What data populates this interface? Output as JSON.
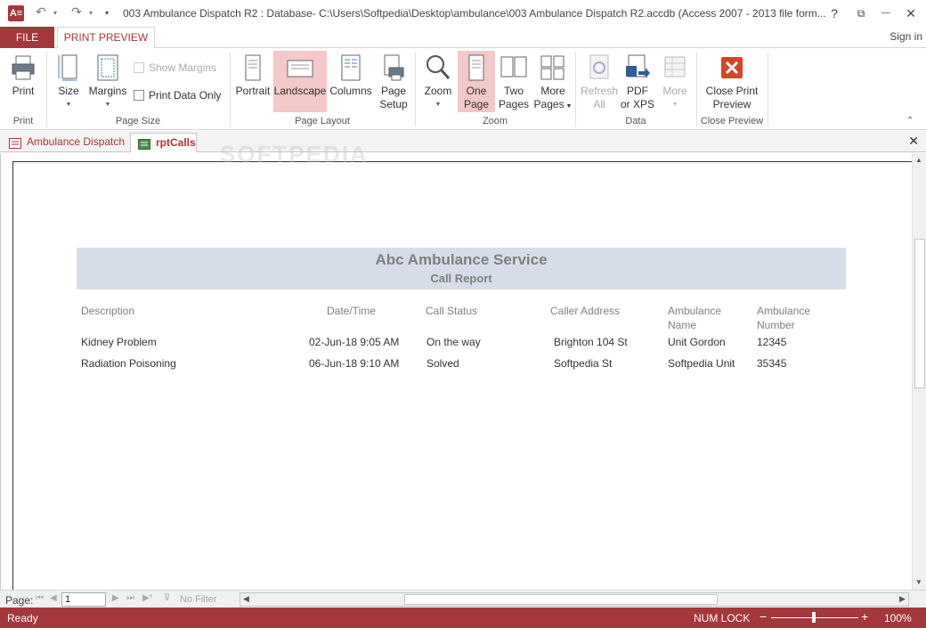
{
  "window": {
    "title": "003 Ambulance Dispatch R2 : Database- C:\\Users\\Softpedia\\Desktop\\ambulance\\003 Ambulance Dispatch R2.accdb (Access 2007 - 2013 file form...",
    "app_icon_text": "A≡",
    "help": "?",
    "restore": "⧉",
    "minimize": "—",
    "maximize": "☐",
    "close": "✕"
  },
  "tabs": {
    "file": "FILE",
    "print_preview": "PRINT PREVIEW",
    "sign_in": "Sign in"
  },
  "ribbon": {
    "print": {
      "label": "Print",
      "group": "Print"
    },
    "page_size": {
      "size": "Size",
      "margins": "Margins",
      "show_margins": "Show Margins",
      "print_data_only": "Print Data Only",
      "group": "Page Size"
    },
    "page_layout": {
      "portrait": "Portrait",
      "landscape": "Landscape",
      "columns": "Columns",
      "page_setup_1": "Page",
      "page_setup_2": "Setup",
      "group": "Page Layout"
    },
    "zoom": {
      "zoom": "Zoom",
      "one_page_1": "One",
      "one_page_2": "Page",
      "two_pages_1": "Two",
      "two_pages_2": "Pages",
      "more_pages_1": "More",
      "more_pages_2": "Pages",
      "group": "Zoom"
    },
    "data": {
      "refresh_1": "Refresh",
      "refresh_2": "All",
      "pdf_1": "PDF",
      "pdf_2": "or XPS",
      "more": "More",
      "group": "Data"
    },
    "close_preview": {
      "label_1": "Close Print",
      "label_2": "Preview",
      "group": "Close Preview"
    }
  },
  "doc_tabs": [
    {
      "label": "Ambulance Dispatch"
    },
    {
      "label": "rptCalls"
    }
  ],
  "watermark": "SOFTPEDIA",
  "report": {
    "title": "Abc Ambulance Service",
    "subtitle": "Call Report",
    "columns": [
      "Description",
      "Date/Time",
      "Call Status",
      "Caller Address",
      "Ambulance Name",
      "Ambulance Number"
    ],
    "rows": [
      [
        "Kidney Problem",
        "02-Jun-18 9:05 AM",
        "On the way",
        "Brighton 104 St",
        "Unit Gordon",
        "12345"
      ],
      [
        "Radiation Poisoning",
        "06-Jun-18 9:10 AM",
        "Solved",
        "Softpedia St",
        "Softpedia Unit",
        "35345"
      ]
    ]
  },
  "navigation": {
    "page_label": "Page:",
    "page_value": "1",
    "no_filter": "No Filter"
  },
  "status": {
    "ready": "Ready",
    "num_lock": "NUM LOCK",
    "zoom_percent": "100%",
    "zoom_level": 1.0
  },
  "colors": {
    "accent": "#a4373a",
    "header_band": "#d7dde8",
    "active_button": "#f4c7c8"
  }
}
